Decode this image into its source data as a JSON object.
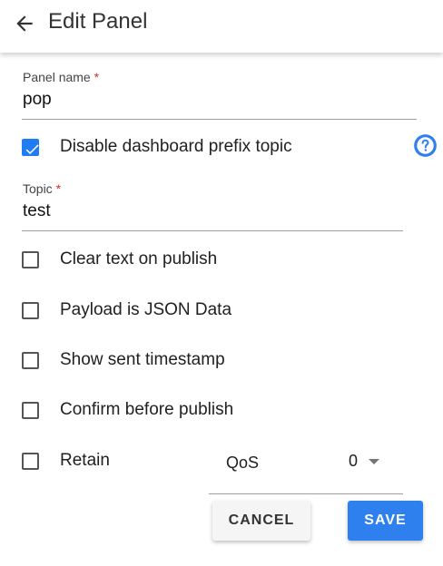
{
  "header": {
    "title": "Edit Panel",
    "back_icon": "arrow-left-icon"
  },
  "form": {
    "panel_name": {
      "label": "Panel name",
      "required_mark": "*",
      "value": "pop"
    },
    "disable_prefix": {
      "label": "Disable dashboard prefix topic",
      "checked": true,
      "help_icon": "question-circle-icon"
    },
    "topic": {
      "label": "Topic",
      "required_mark": "*",
      "value": "test"
    },
    "options": [
      {
        "label": "Clear text on publish",
        "checked": false
      },
      {
        "label": "Payload is JSON Data",
        "checked": false
      },
      {
        "label": "Show sent timestamp",
        "checked": false
      },
      {
        "label": "Confirm before publish",
        "checked": false
      },
      {
        "label": "Retain",
        "checked": false
      }
    ],
    "qos": {
      "label": "QoS",
      "value": "0"
    }
  },
  "actions": {
    "cancel_label": "CANCEL",
    "save_label": "SAVE"
  },
  "colors": {
    "accent": "#1f7df1",
    "save_button": "#2f80ef",
    "required": "#d32f2f"
  }
}
